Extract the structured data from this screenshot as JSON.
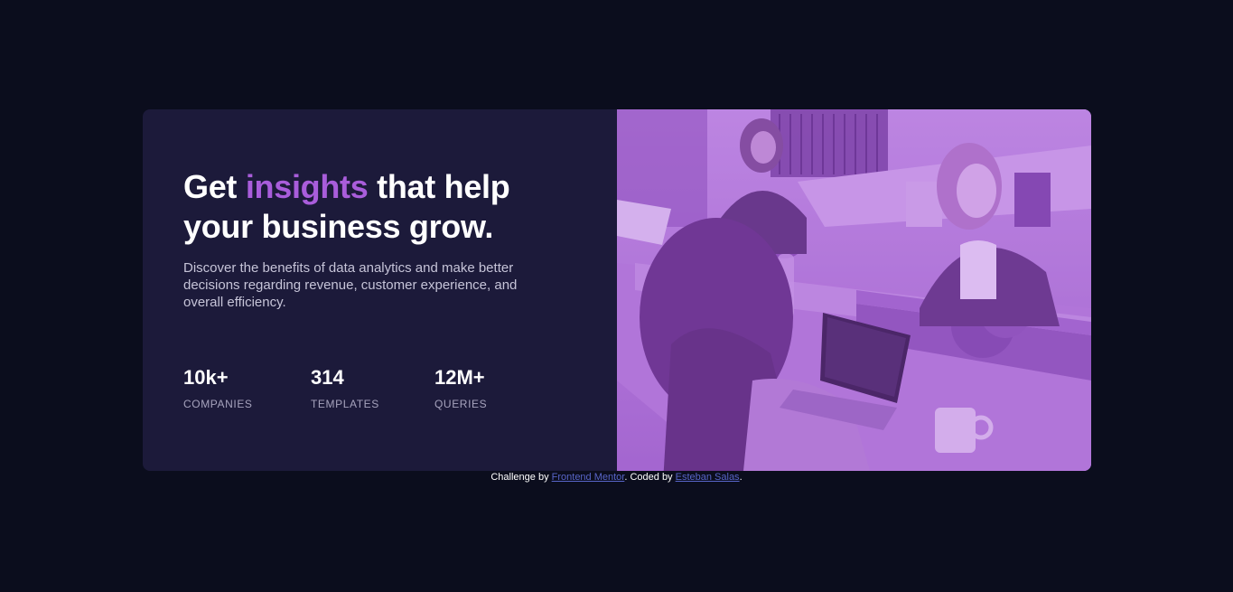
{
  "card": {
    "headline": {
      "before": "Get ",
      "accent": "insights",
      "after": " that help your business grow."
    },
    "description": "Discover the benefits of data analytics and make better decisions regarding revenue, customer experience, and overall efficiency.",
    "stats": [
      {
        "value": "10k+",
        "label": "COMPANIES"
      },
      {
        "value": "314",
        "label": "TEMPLATES"
      },
      {
        "value": "12M+",
        "label": "QUERIES"
      }
    ]
  },
  "attribution": {
    "prefix": "Challenge by ",
    "link1": "Frontend Mentor",
    "middle": ". Coded by ",
    "link2": "Esteban Salas",
    "suffix": "."
  },
  "colors": {
    "background": "#0b0d1d",
    "card": "#1c1a3a",
    "accent": "#a95ddb",
    "image_overlay": "#9b63c4"
  }
}
